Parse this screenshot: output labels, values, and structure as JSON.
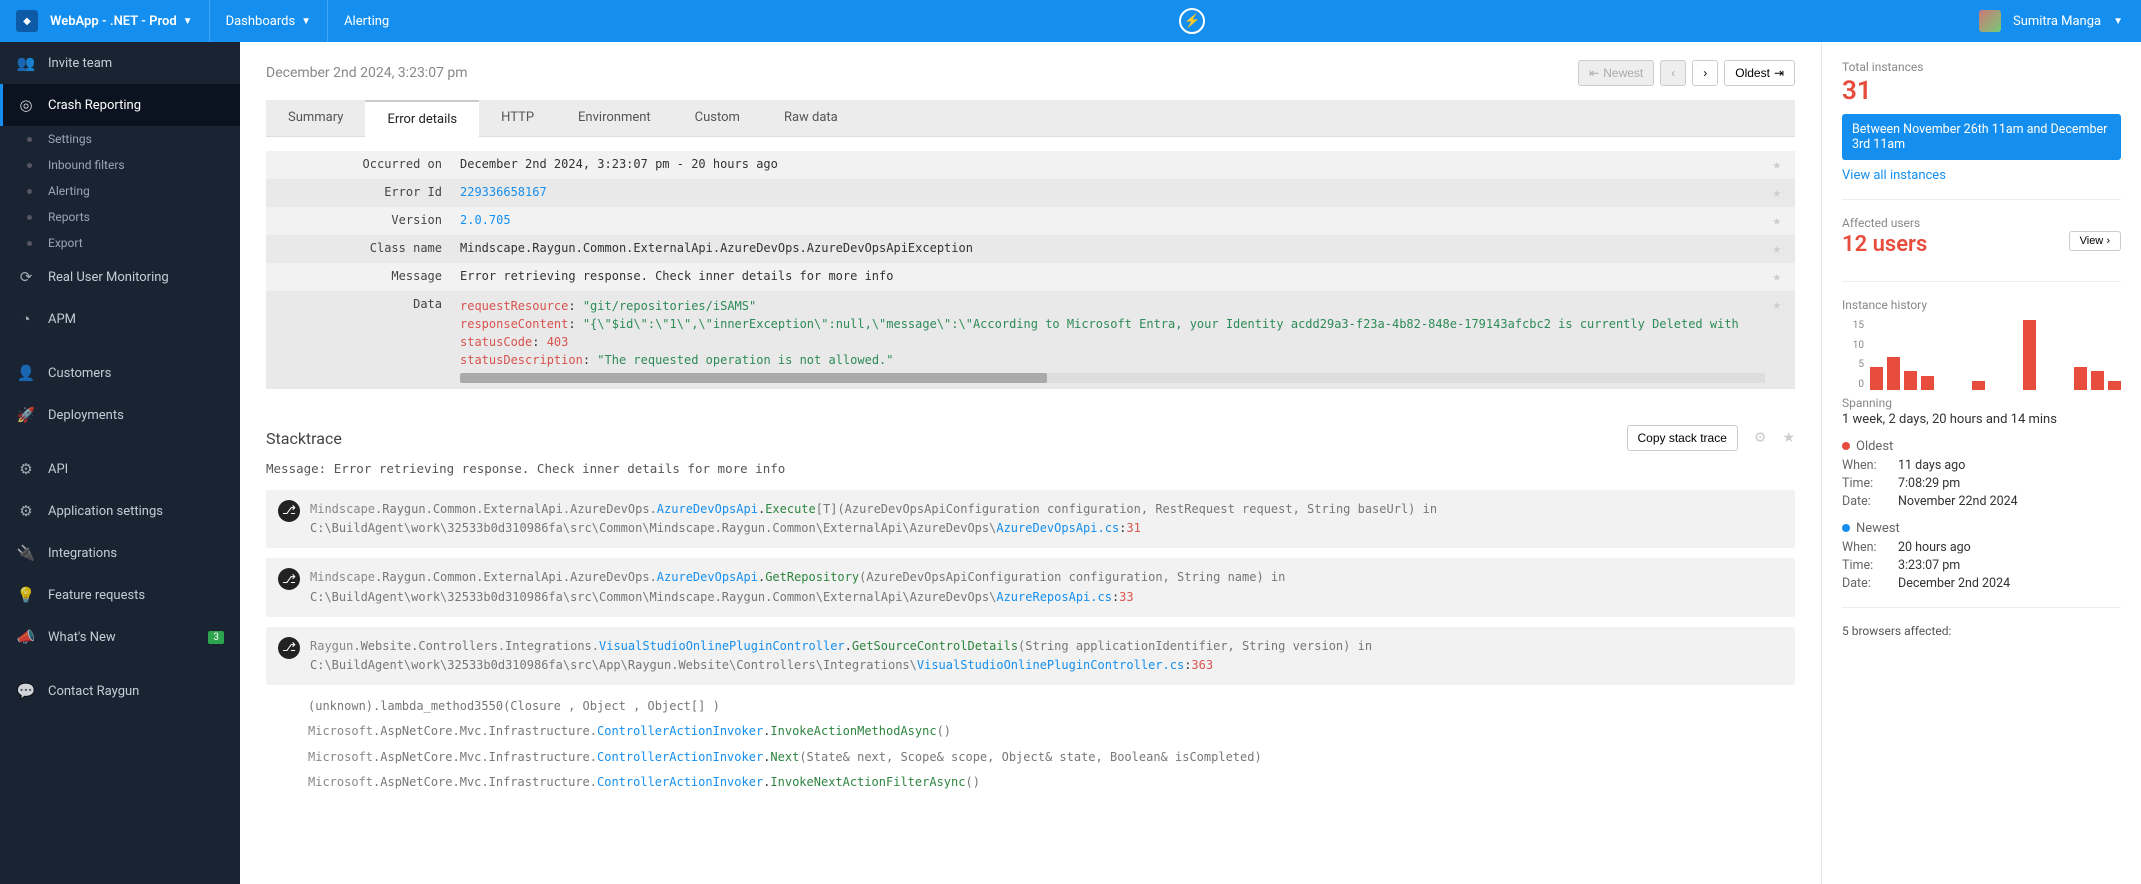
{
  "topbar": {
    "app_name": "WebApp - .NET - Prod",
    "dashboards": "Dashboards",
    "alerting": "Alerting",
    "user_name": "Sumitra Manga"
  },
  "sidebar": {
    "invite": "Invite team",
    "crash": "Crash Reporting",
    "subs": [
      "Settings",
      "Inbound filters",
      "Alerting",
      "Reports",
      "Export"
    ],
    "rum": "Real User Monitoring",
    "apm": "APM",
    "customers": "Customers",
    "deployments": "Deployments",
    "api": "API",
    "appsettings": "Application settings",
    "integrations": "Integrations",
    "features": "Feature requests",
    "whatsnew": "What's New",
    "whatsnew_badge": "3",
    "contact": "Contact Raygun"
  },
  "main": {
    "timestamp": "December 2nd 2024, 3:23:07 pm",
    "pager": {
      "newest": "Newest",
      "oldest": "Oldest"
    },
    "tabs": [
      "Summary",
      "Error details",
      "HTTP",
      "Environment",
      "Custom",
      "Raw data"
    ],
    "details": {
      "occurred_on_label": "Occurred on",
      "occurred_on": "December 2nd 2024, 3:23:07 pm - 20 hours ago",
      "error_id_label": "Error Id",
      "error_id": "229336658167",
      "version_label": "Version",
      "version": "2.0.705",
      "class_label": "Class name",
      "class": "Mindscape.Raygun.Common.ExternalApi.AzureDevOps.AzureDevOpsApiException",
      "message_label": "Message",
      "message": "Error retrieving response. Check inner details for more info",
      "data_label": "Data",
      "data": {
        "requestResource_k": "requestResource",
        "requestResource_v": "\"git/repositories/iSAMS\"",
        "responseContent_k": "responseContent",
        "responseContent_v": "\"{\\\"$id\\\":\\\"1\\\",\\\"innerException\\\":null,\\\"message\\\":\\\"According to Microsoft Entra, your Identity acdd29a3-f23a-4b82-848e-179143afcbc2 is currently Deleted with",
        "statusCode_k": "statusCode",
        "statusCode_v": "403",
        "statusDesc_k": "statusDescription",
        "statusDesc_v": "\"The requested operation is not allowed.\""
      }
    },
    "stack": {
      "title": "Stacktrace",
      "copy": "Copy stack trace",
      "msg": "Message: Error retrieving response. Check inner details for more info",
      "f1": {
        "ns": "Mindscape",
        "rest": ".Raygun.Common.ExternalApi.AzureDevOps.",
        "cls": "AzureDevOpsApi",
        "mth": "Execute",
        "sig": "[T](AzureDevOpsApiConfiguration configuration, RestRequest request, String baseUrl) in",
        "path": "C:\\BuildAgent\\work\\32533b0d310986fa\\src\\Common\\Mindscape.Raygun.Common\\ExternalApi\\AzureDevOps\\",
        "file": "AzureDevOpsApi.cs",
        "ln": "31"
      },
      "f2": {
        "ns": "Mindscape",
        "rest": ".Raygun.Common.ExternalApi.AzureDevOps.",
        "cls": "AzureDevOpsApi",
        "mth": "GetRepository",
        "sig": "(AzureDevOpsApiConfiguration configuration, String name) in",
        "path": "C:\\BuildAgent\\work\\32533b0d310986fa\\src\\Common\\Mindscape.Raygun.Common\\ExternalApi\\AzureDevOps\\",
        "file": "AzureReposApi.cs",
        "ln": "33"
      },
      "f3": {
        "ns": "Raygun",
        "rest": ".Website.Controllers.Integrations.",
        "cls": "VisualStudioOnlinePluginController",
        "mth": "GetSourceControlDetails",
        "sig": "(String applicationIdentifier, String version) in",
        "path": "C:\\BuildAgent\\work\\32533b0d310986fa\\src\\App\\Raygun.Website\\Controllers\\Integrations\\",
        "file": "VisualStudioOnlinePluginController.cs",
        "ln": "363"
      },
      "p1": "(unknown).lambda_method3550(Closure , Object , Object[] )",
      "p2_pre": "Microsoft",
      "p2_rest": ".AspNetCore.Mvc.Infrastructure.",
      "p2_cls": "ControllerActionInvoker",
      "p2_mth": "InvokeActionMethodAsync",
      "p2_suf": "()",
      "p3_pre": "Microsoft",
      "p3_rest": ".AspNetCore.Mvc.Infrastructure.",
      "p3_cls": "ControllerActionInvoker",
      "p3_mth": "Next",
      "p3_suf": "(State& next, Scope& scope, Object& state, Boolean& isCompleted)",
      "p4_pre": "Microsoft",
      "p4_rest": ".AspNetCore.Mvc.Infrastructure.",
      "p4_cls": "ControllerActionInvoker",
      "p4_mth": "InvokeNextActionFilterAsync",
      "p4_suf": "()"
    }
  },
  "rpanel": {
    "total_label": "Total instances",
    "total": "31",
    "range": "Between November 26th 11am and December 3rd 11am",
    "view_all": "View all instances",
    "affected_label": "Affected users",
    "affected": "12 users",
    "view_btn": "View",
    "hist_label": "Instance history",
    "spanning_label": "Spanning",
    "spanning": "1 week, 2 days, 20 hours and 14 mins",
    "oldest_label": "Oldest",
    "oldest_when": "11 days ago",
    "oldest_time": "7:08:29 pm",
    "oldest_date": "November 22nd 2024",
    "newest_label": "Newest",
    "newest_when": "20 hours ago",
    "newest_time": "3:23:07 pm",
    "newest_date": "December 2nd 2024",
    "browsers": "5 browsers affected:",
    "when": "When:",
    "time": "Time:",
    "date": "Date:"
  },
  "chart_data": {
    "type": "bar",
    "ylim": [
      0,
      15
    ],
    "yticks": [
      0,
      5,
      10,
      15
    ],
    "values": [
      5,
      7,
      4,
      3,
      0,
      0,
      2,
      0,
      0,
      15,
      0,
      0,
      5,
      4,
      2
    ]
  }
}
